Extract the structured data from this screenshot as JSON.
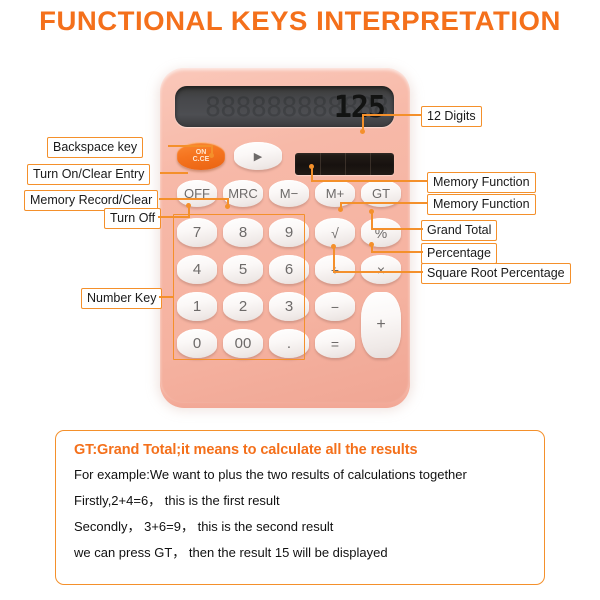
{
  "title": "FUNCTIONAL KEYS INTERPRETATION",
  "accent_color": "#F4701B",
  "label_border_color": "#F4902B",
  "calculator": {
    "body_color": "#F5B2A0",
    "display": {
      "value": "125",
      "ghost_digits": "888888888888",
      "digit_capacity": "12"
    },
    "solar_panel": "solar-panel",
    "keys": {
      "on_ce": {
        "line1": "ON",
        "line2": "C.CE"
      },
      "backspace": "▶",
      "off": "OFF",
      "mrc": "MRC",
      "m_minus": "M−",
      "m_plus": "M+",
      "gt": "GT",
      "row1": [
        "7",
        "8",
        "9"
      ],
      "row2": [
        "4",
        "5",
        "6"
      ],
      "row3": [
        "1",
        "2",
        "3"
      ],
      "row4": [
        "0",
        "00",
        "."
      ],
      "sqrt": "√",
      "percent": "%",
      "divide": "÷",
      "multiply": "×",
      "minus": "−",
      "equals": "=",
      "plus": "+"
    }
  },
  "annotations_left": [
    {
      "id": "backspace-key",
      "text": "Backspace key"
    },
    {
      "id": "turn-on-clear-entry",
      "text": "Turn On/Clear Entry"
    },
    {
      "id": "memory-record-clear",
      "text": "Memory Record/Clear"
    },
    {
      "id": "turn-off",
      "text": "Turn Off"
    },
    {
      "id": "number-key",
      "text": "Number Key"
    }
  ],
  "annotations_right": [
    {
      "id": "twelve-digits",
      "text": "12 Digits"
    },
    {
      "id": "memory-function-1",
      "text": "Memory Function"
    },
    {
      "id": "memory-function-2",
      "text": "Memory Function"
    },
    {
      "id": "grand-total",
      "text": "Grand Total"
    },
    {
      "id": "percentage",
      "text": "Percentage"
    },
    {
      "id": "square-root-percentage",
      "text": "Square Root Percentage"
    }
  ],
  "note": {
    "heading": "GT:Grand Total;it means to calculate all the results",
    "line1": "For example:We want to plus the two  results of calculations together",
    "line2": "Firstly,2+4=6， this is the first result",
    "line3": "Secondly， 3+6=9， this is the second result",
    "line4": "we can press GT， then the result 15 will be displayed"
  }
}
